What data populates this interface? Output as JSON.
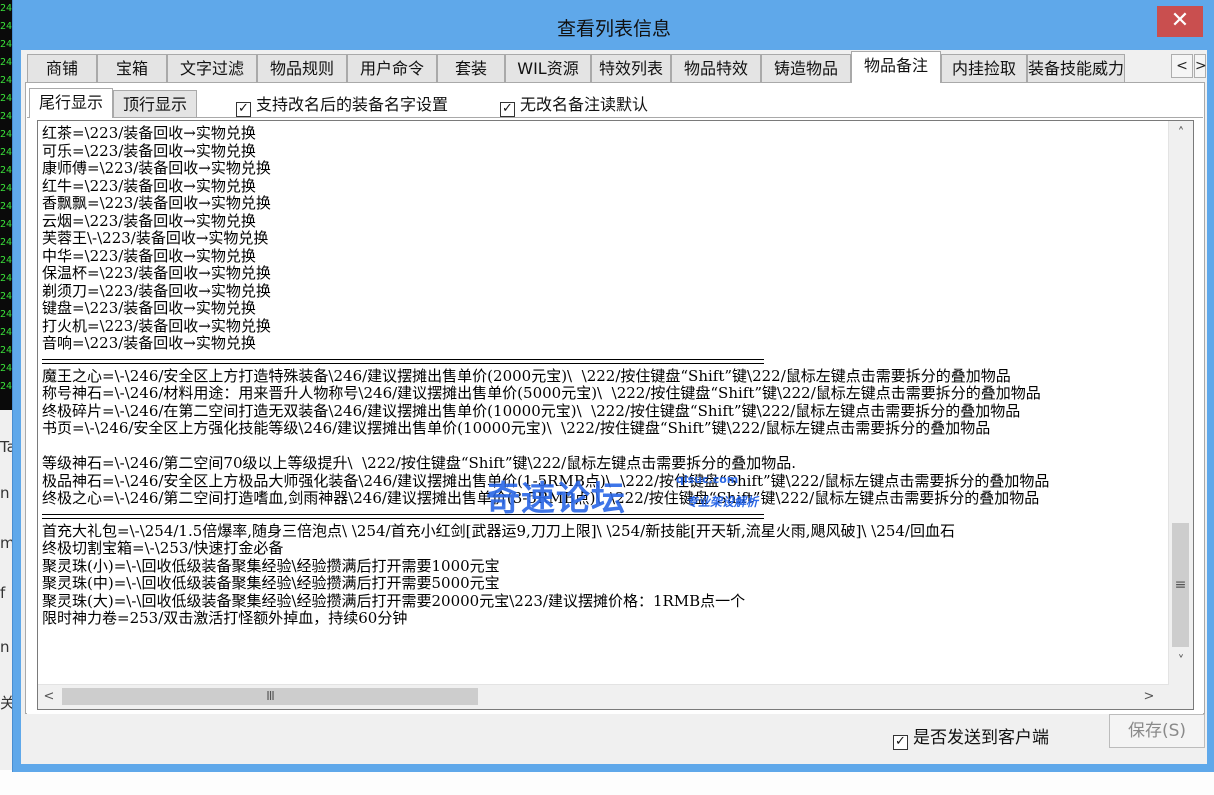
{
  "window": {
    "title": "查看列表信息",
    "close_glyph": "✕"
  },
  "background": {
    "terminal_glyph": "24",
    "left_chars": [
      "Ta",
      "n",
      "m",
      "f",
      "n",
      "关"
    ]
  },
  "tabs": [
    {
      "label": "商铺",
      "active": false
    },
    {
      "label": "宝箱",
      "active": false
    },
    {
      "label": "文字过滤",
      "active": false
    },
    {
      "label": "物品规则",
      "active": false
    },
    {
      "label": "用户命令",
      "active": false
    },
    {
      "label": "套装",
      "active": false
    },
    {
      "label": "WIL资源",
      "active": false
    },
    {
      "label": "特效列表",
      "active": false
    },
    {
      "label": "物品特效",
      "active": false
    },
    {
      "label": "铸造物品",
      "active": false
    },
    {
      "label": "物品备注",
      "active": true
    },
    {
      "label": "内挂捡取",
      "active": false
    },
    {
      "label": "装备技能威力",
      "active": false
    }
  ],
  "tab_scroll": {
    "left": "<",
    "right": ">"
  },
  "subtabs": [
    {
      "label": "尾行显示",
      "active": true
    },
    {
      "label": "顶行显示",
      "active": false
    }
  ],
  "options": {
    "rename_support": {
      "label": "支持改名后的装备名字设置",
      "checked": true,
      "mark": "✓"
    },
    "default_read": {
      "label": "无改名备注读默认",
      "checked": true,
      "mark": "✓"
    }
  },
  "editor": {
    "lines": [
      "红茶=\\223/装备回收→实物兑换",
      "可乐=\\223/装备回收→实物兑换",
      "康师傅=\\223/装备回收→实物兑换",
      "红牛=\\223/装备回收→实物兑换",
      "香飘飘=\\223/装备回收→实物兑换",
      "云烟=\\223/装备回收→实物兑换",
      "芙蓉王\\-\\223/装备回收→实物兑换",
      "中华=\\223/装备回收→实物兑换",
      "保温杯=\\223/装备回收→实物兑换",
      "剃须刀=\\223/装备回收→实物兑换",
      "键盘=\\223/装备回收→实物兑换",
      "打火机=\\223/装备回收→实物兑换",
      "音响=\\223/装备回收→实物兑换",
      "---",
      "魔王之心=\\-\\246/安全区上方打造特殊装备\\246/建议摆摊出售单价(2000元宝)\\  \\222/按住键盘“Shift”键\\222/鼠标左键点击需要拆分的叠加物品",
      "称号神石=\\-\\246/材料用途：用来晋升人物称号\\246/建议摆摊出售单价(5000元宝)\\  \\222/按住键盘“Shift”键\\222/鼠标左键点击需要拆分的叠加物品",
      "终极碎片=\\-\\246/在第二空间打造无双装备\\246/建议摆摊出售单价(10000元宝)\\  \\222/按住键盘“Shift”键\\222/鼠标左键点击需要拆分的叠加物品",
      "书页=\\-\\246/安全区上方强化技能等级\\246/建议摆摊出售单价(10000元宝)\\  \\222/按住键盘“Shift”键\\222/鼠标左键点击需要拆分的叠加物品",
      "",
      "等级神石=\\-\\246/第二空间70级以上等级提升\\  \\222/按住键盘“Shift”键\\222/鼠标左键点击需要拆分的叠加物品.",
      "极品神石=\\-\\246/安全区上方极品大师强化装备\\246/建议摆摊出售单价(1-5RMB点)\\  \\222/按住键盘“Shift”键\\222/鼠标左键点击需要拆分的叠加物品",
      "终极之心=\\-\\246/第二空间打造嗜血,剑雨神器\\246/建议摆摊出售单价(3-5RMB点)\\  \\222/按住键盘“Shift”键\\222/鼠标左键点击需要拆分的叠加物品",
      "---",
      "首充大礼包=\\-\\254/1.5倍爆率,随身三倍泡点\\ \\254/首充小红剑[武器运9,刀刀上限]\\ \\254/新技能[开天斩,流星火雨,飓风破]\\ \\254/回血石",
      "终极切割宝箱=\\-\\253/快速打金必备",
      "聚灵珠(小)=\\-\\回收低级装备聚集经验\\经验攒满后打开需要1000元宝",
      "聚灵珠(中)=\\-\\回收低级装备聚集经验\\经验攒满后打开需要5000元宝",
      "聚灵珠(大)=\\-\\回收低级装备聚集经验\\经验攒满后打开需要20000元宝\\223/建议摆摊价格：1RMB点一个",
      "限时神力卷=253/双击激活打怪额外掉血，持续60分钟"
    ]
  },
  "scrollbars": {
    "up": "˄",
    "down": "˅",
    "left": "<",
    "right": ">",
    "v_grip": "≡",
    "h_grip": "III"
  },
  "watermark": {
    "main": "奇速论坛",
    "url": "qisuc.com",
    "sub": "专业架设解析"
  },
  "footer": {
    "send_to_client": {
      "label": "是否发送到客户端",
      "checked": true,
      "mark": "✓"
    },
    "save_label": "保存(S)"
  },
  "colors": {
    "titlebar": "#5fa8ea",
    "close_button": "#c94f4f",
    "client_bg": "#f0f0f0",
    "watermark": "#2a67e6"
  }
}
